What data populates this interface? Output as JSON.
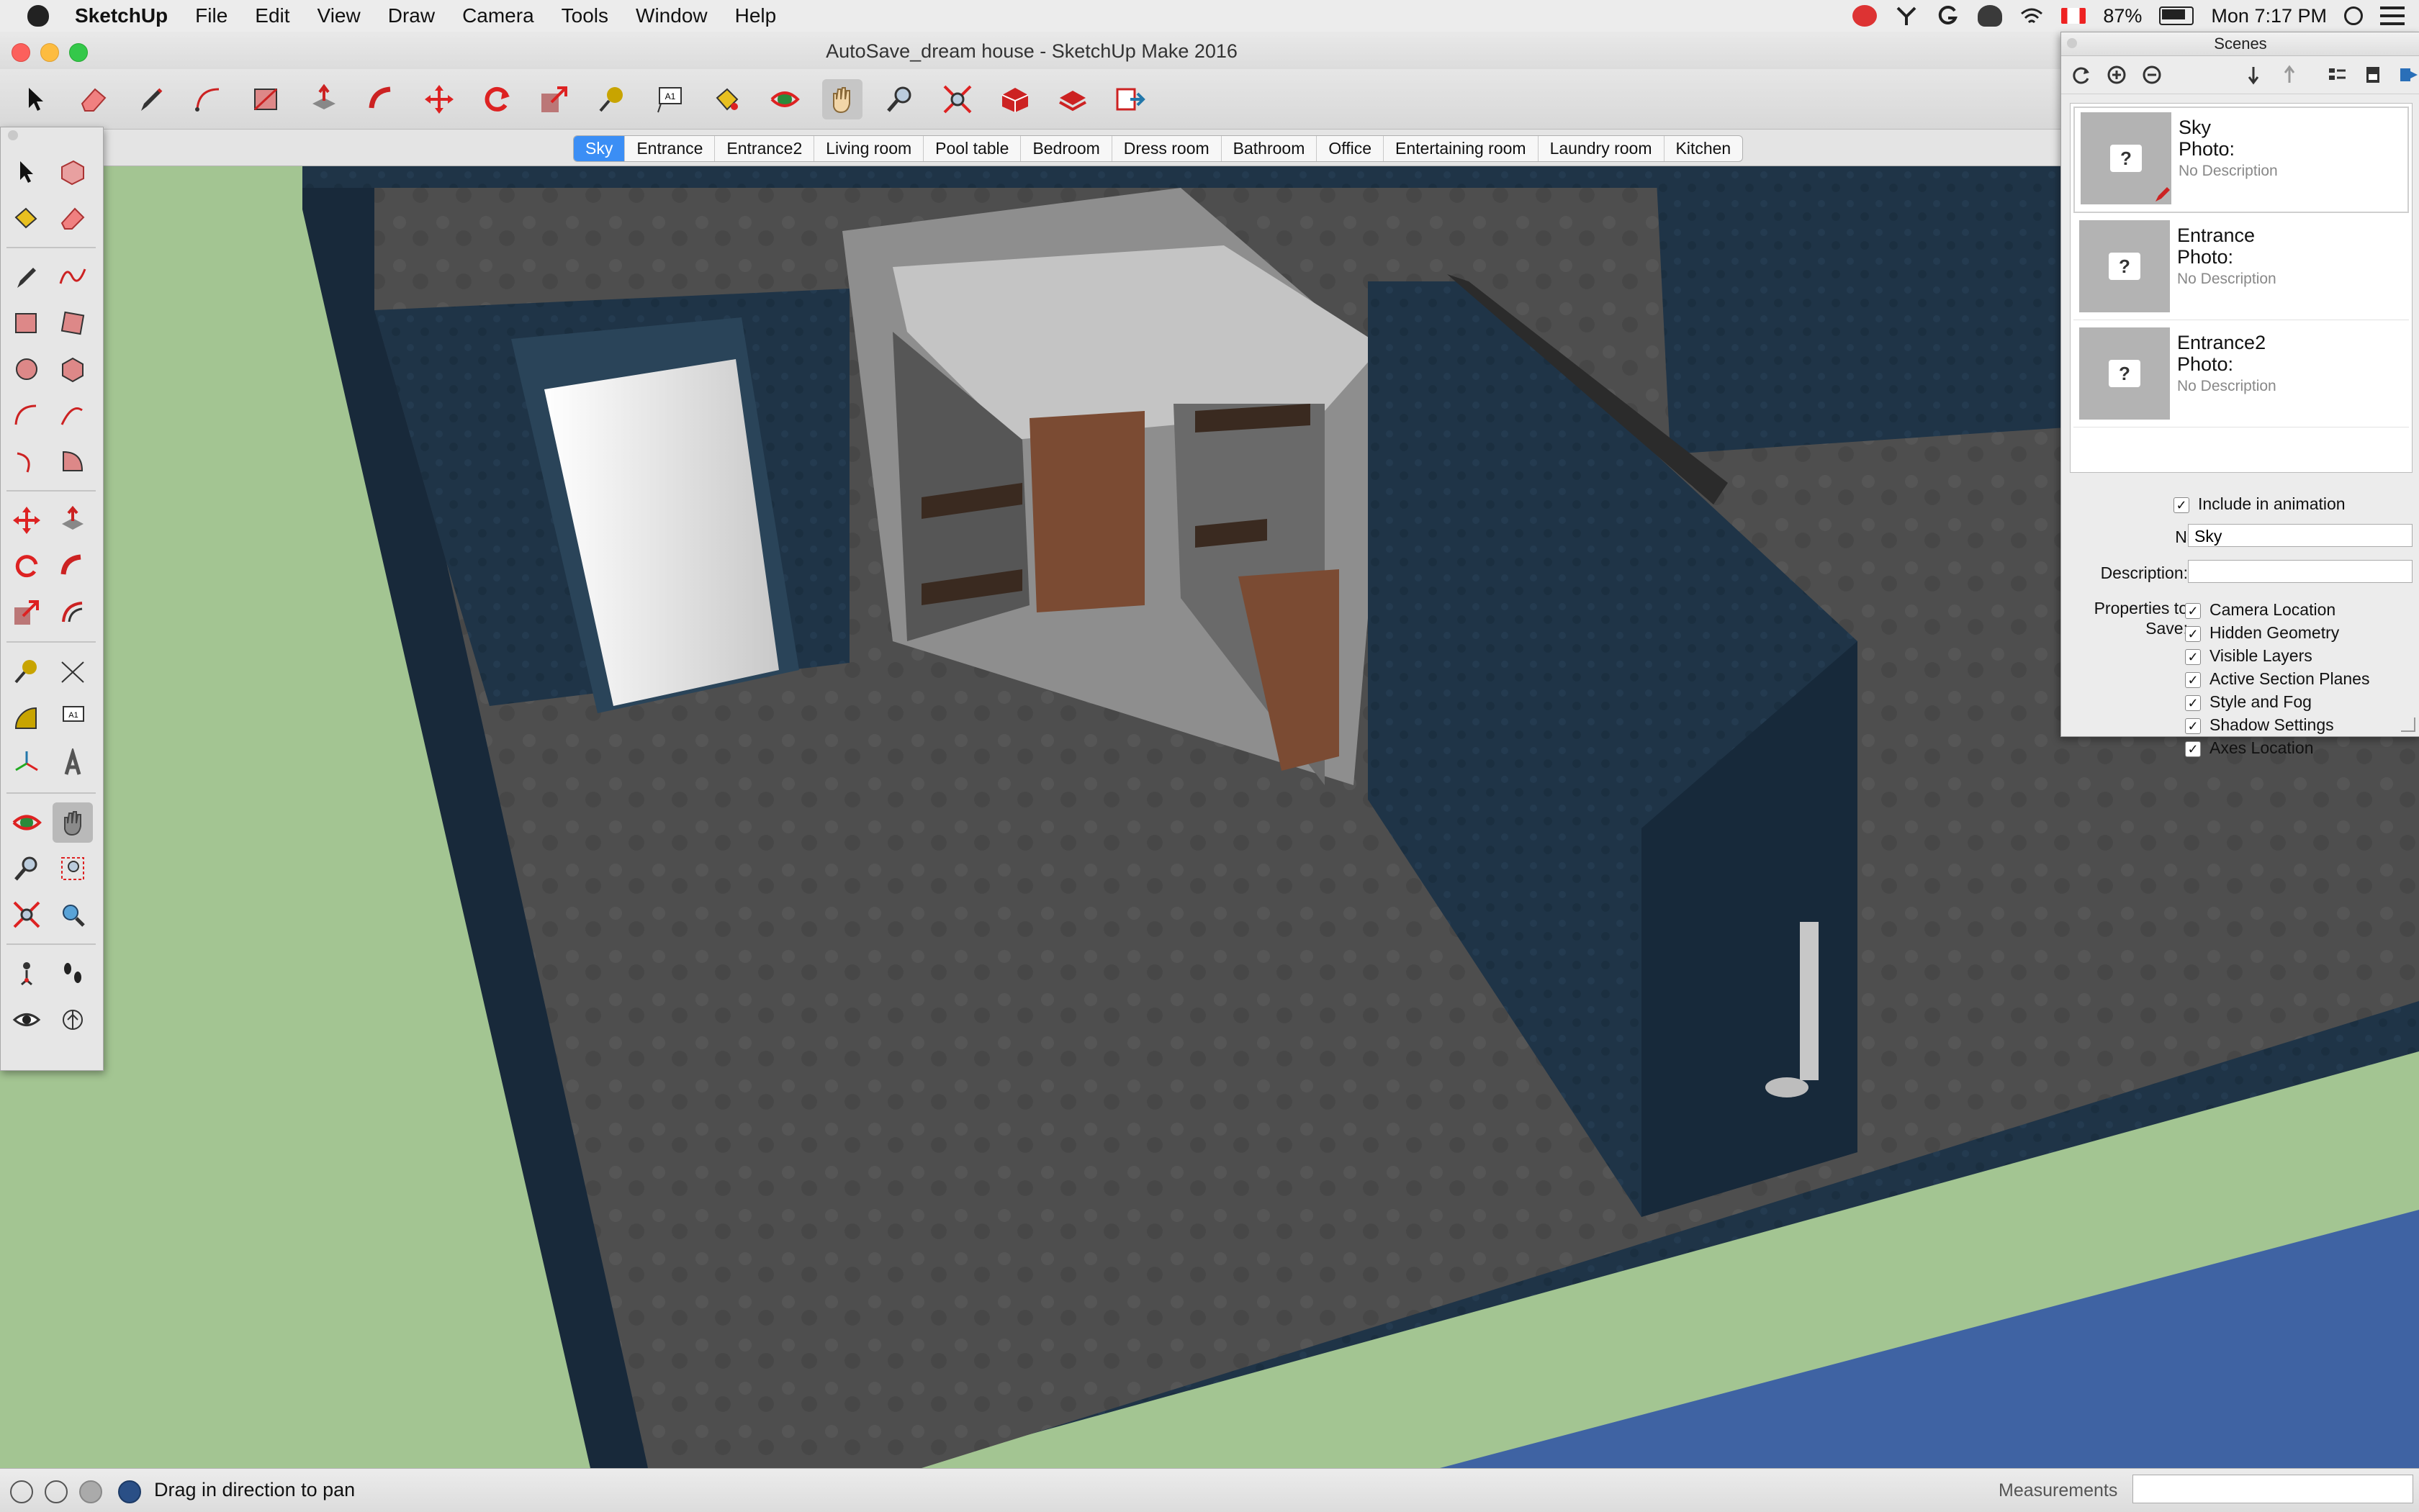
{
  "menubar": {
    "app_name": "SketchUp",
    "menus": [
      "File",
      "Edit",
      "View",
      "Draw",
      "Camera",
      "Tools",
      "Window",
      "Help"
    ],
    "battery": "87%",
    "clock": "Mon 7:17 PM"
  },
  "window": {
    "title": "AutoSave_dream house - SketchUp Make 2016"
  },
  "toolbar": {
    "tools": [
      "select",
      "eraser",
      "pencil",
      "arc",
      "rectangle",
      "push-pull",
      "follow-me",
      "move",
      "rotate",
      "scale",
      "tape-measure",
      "text",
      "paint-bucket",
      "orbit",
      "pan",
      "zoom",
      "zoom-extents",
      "3d-warehouse",
      "extension-warehouse",
      "send-to-layout"
    ],
    "active_tool": "pan"
  },
  "scene_tabs": {
    "items": [
      "Sky",
      "Entrance",
      "Entrance2",
      "Living room",
      "Pool table",
      "Bedroom",
      "Dress room",
      "Bathroom",
      "Office",
      "Entertaining room",
      "Laundry room",
      "Kitchen"
    ],
    "selected": "Sky"
  },
  "scenes_panel": {
    "title": "Scenes",
    "list": [
      {
        "name": "Sky",
        "photo_label": "Photo:",
        "description": "No Description"
      },
      {
        "name": "Entrance",
        "photo_label": "Photo:",
        "description": "No Description"
      },
      {
        "name": "Entrance2",
        "photo_label": "Photo:",
        "description": "No Description"
      }
    ],
    "include_in_animation": "Include in animation",
    "name_label": "Name:",
    "name_value": "Sky",
    "description_label": "Description:",
    "description_value": "",
    "properties_label_1": "Properties to",
    "properties_label_2": "Save:",
    "properties": [
      "Camera Location",
      "Hidden Geometry",
      "Visible Layers",
      "Active Section Planes",
      "Style and Fog",
      "Shadow Settings",
      "Axes Location"
    ]
  },
  "statusbar": {
    "hint": "Drag in direction to pan",
    "measurements_label": "Measurements",
    "measurements_value": ""
  },
  "colors": {
    "wall": "#1f3447",
    "floor": "#4f4f4f",
    "grass": "#a3c592",
    "tab_selected": "#3b8ef5"
  }
}
